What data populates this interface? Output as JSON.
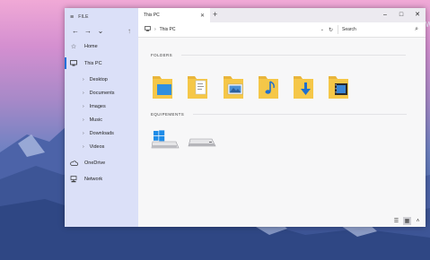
{
  "window": {
    "menu_label": "FILE",
    "tab_title": "This PC",
    "new_tab_glyph": "+",
    "controls": {
      "minimize": "–",
      "maximize": "□",
      "close": "✕"
    }
  },
  "nav": {
    "back": "←",
    "forward": "→",
    "history": "⌄",
    "up": "↑",
    "items": [
      {
        "label": "Home",
        "icon": "star-icon"
      },
      {
        "label": "This PC",
        "icon": "monitor-icon",
        "selected": true
      },
      {
        "label": "Desktop"
      },
      {
        "label": "Documents"
      },
      {
        "label": "Images"
      },
      {
        "label": "Music"
      },
      {
        "label": "Downloads"
      },
      {
        "label": "Videos"
      },
      {
        "label": "OneDrive",
        "icon": "cloud-icon"
      },
      {
        "label": "Network",
        "icon": "network-icon"
      }
    ]
  },
  "address": {
    "location": "This PC",
    "search_placeholder": "Search"
  },
  "sections": {
    "folders": "FOLDERS",
    "devices": "EQUIPEMENTS"
  },
  "folders": [
    "desktop-folder-icon",
    "documents-folder-icon",
    "pictures-folder-icon",
    "music-folder-icon",
    "downloads-folder-icon",
    "videos-folder-icon"
  ],
  "drives": [
    "windows-drive-icon",
    "drive-icon"
  ],
  "desktop_fragment": "W",
  "colors": {
    "accent": "#1e6fd9",
    "folder": "#f5c748"
  }
}
